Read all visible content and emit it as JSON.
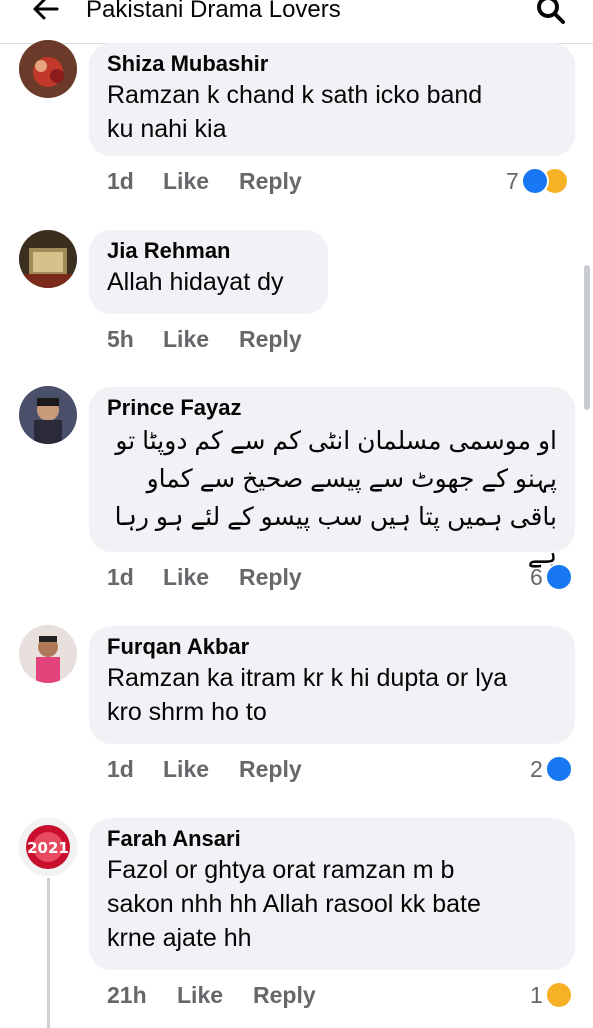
{
  "header": {
    "title": "Pakistani Drama Lovers",
    "back_icon": "back-arrow-icon",
    "search_icon": "search-icon"
  },
  "colors": {
    "bubble": "#f0f2f5",
    "action_text": "#65676b",
    "like_blue": "#1877f2",
    "haha_yellow": "#f7b125"
  },
  "comments": [
    {
      "author": "Shiza Mubashir",
      "text": "Ramzan k chand k sath icko band\nku nahi kia",
      "time": "1d",
      "like": "Like",
      "reply": "Reply",
      "reaction_count": "7",
      "reactions": [
        "like",
        "haha"
      ]
    },
    {
      "author": "Jia Rehman",
      "text": "Allah hidayat dy",
      "time": "5h",
      "like": "Like",
      "reply": "Reply"
    },
    {
      "author": "Prince Fayaz",
      "text": "او موسمی مسلمان انٹی کم سے کم دوپٹا تو\nپہنو کے جھوٹ سے پیسے صحیخ سے کماو\nباقی ہمیں پتا ہیں سب پیسو کے لئے ہو رہا ہے",
      "time": "1d",
      "like": "Like",
      "reply": "Reply",
      "reaction_count": "6",
      "reactions": [
        "like"
      ]
    },
    {
      "author": "Furqan Akbar",
      "text": "Ramzan ka itram kr k hi dupta or lya\nkro shrm ho to",
      "time": "1d",
      "like": "Like",
      "reply": "Reply",
      "reaction_count": "2",
      "reactions": [
        "like"
      ]
    },
    {
      "author": "Farah Ansari",
      "text": "Fazol or ghtya orat ramzan m b\nsakon nhh hh Allah rasool kk bate\nkrne ajate hh",
      "time": "21h",
      "like": "Like",
      "reply": "Reply",
      "reaction_count": "1",
      "reactions": [
        "haha"
      ],
      "avatar_badge": "2021"
    }
  ]
}
